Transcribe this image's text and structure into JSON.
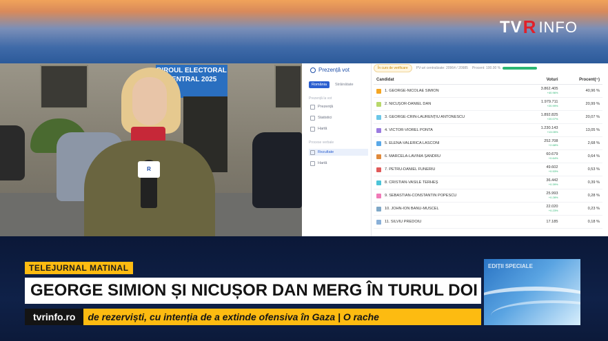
{
  "channel": {
    "logo_tv": "TV",
    "logo_r": "R",
    "logo_info": "INFO"
  },
  "scene": {
    "banner": "BIROUL ELECTORAL CENTRAL 2025",
    "mic_label": "R"
  },
  "sidebar": {
    "brand": "Prezență vot",
    "toggle": [
      "România",
      "Străinătate"
    ],
    "section1": "Prezență la vot",
    "items1": [
      "Prezență",
      "Statistici",
      "Hartă"
    ],
    "section2": "Procese verbale",
    "items2": [
      "Rezultate",
      "Hartă"
    ]
  },
  "status": {
    "chip": "În curs de verificare",
    "pv": "PV-uri centralizate: 20964 / 20985",
    "progress": "Procent: 100.00 %"
  },
  "table": {
    "headers": [
      "Candidat",
      "Voturi",
      "Procent(~)"
    ],
    "rows": [
      {
        "name": "1. GEORGE-NICOLAE SIMION",
        "votes": "3.862.405",
        "delta": "+40.96%",
        "pct": "40,96 %",
        "color": "#f5a623"
      },
      {
        "name": "2. NICUȘOR-DANIEL DAN",
        "votes": "1.979.711",
        "delta": "+20.99%",
        "pct": "20,99 %",
        "color": "#b8d86b"
      },
      {
        "name": "3. GEORGE-CRIN-LAURENȚIU ANTONESCU",
        "votes": "1.892.825",
        "delta": "+20.07%",
        "pct": "20,07 %",
        "color": "#6cc7e8"
      },
      {
        "name": "4. VICTOR-VIOREL PONTA",
        "votes": "1.230.143",
        "delta": "+13.05%",
        "pct": "13,05 %",
        "color": "#9b7be0"
      },
      {
        "name": "5. ELENA-VALERICA LASCONI",
        "votes": "252.708",
        "delta": "+2.68%",
        "pct": "2,68 %",
        "color": "#5aa8e8"
      },
      {
        "name": "6. MARCELA-LAVINIA ȘANDRU",
        "votes": "60.679",
        "delta": "+0.64%",
        "pct": "0,64 %",
        "color": "#e08a3c"
      },
      {
        "name": "7. PETRU-DANIEL FUNERIU",
        "votes": "49.602",
        "delta": "+0.53%",
        "pct": "0,53 %",
        "color": "#e05a5a"
      },
      {
        "name": "8. CRISTIAN-VASILE TERHEȘ",
        "votes": "36.442",
        "delta": "+0.39%",
        "pct": "0,39 %",
        "color": "#4cc4d8"
      },
      {
        "name": "9. SEBASTIAN-CONSTANTIN POPESCU",
        "votes": "25.993",
        "delta": "+0.28%",
        "pct": "0,28 %",
        "color": "#f07ab8"
      },
      {
        "name": "10. JOHN-ION BANU-MUSCEL",
        "votes": "22.020",
        "delta": "+0.23%",
        "pct": "0,23 %",
        "color": "#7fa8c8"
      },
      {
        "name": "11. SILVIU PREDOIU",
        "votes": "17.185",
        "delta": "",
        "pct": "0,18 %",
        "color": "#8ab0d8"
      }
    ]
  },
  "lower_third": {
    "tag": "TELEJURNAL MATINAL",
    "headline": "GEORGE SIMION ȘI NICUȘOR DAN MERG ÎN TURUL DOI",
    "site": "tvrinfo.ro",
    "ticker": "de rezerviști, cu intenția de a extinde ofensiva în Gaza   |   O rache",
    "promo": "EDIȚII SPECIALE"
  },
  "colors": {
    "accent_yellow": "#fdbb11",
    "brand_red": "#e0202a",
    "panel_blue": "#2b5fd0"
  }
}
